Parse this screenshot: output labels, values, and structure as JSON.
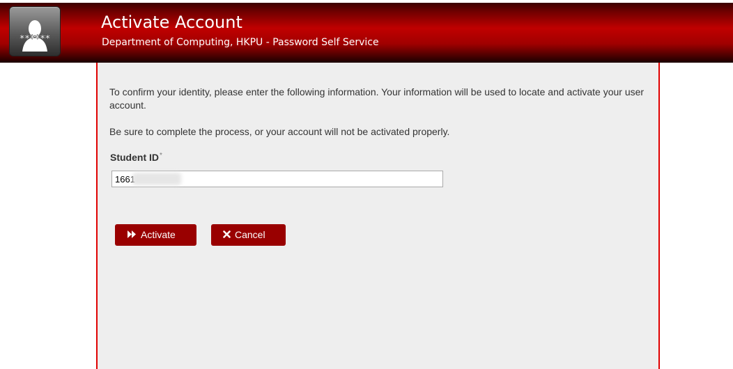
{
  "header": {
    "title": "Activate Account",
    "subtitle": "Department of Computing, HKPU - Password Self Service",
    "logo_icon": "user-password-icon",
    "logo_text": "******"
  },
  "form": {
    "intro": "To confirm your identity, please enter the following information. Your information will be used to locate and activate your user account.",
    "warning": "Be sure to complete the process, or your account will not be activated properly.",
    "student_id": {
      "label": "Student ID",
      "required_mark": "*",
      "value": "1661"
    }
  },
  "buttons": {
    "activate": {
      "label": "Activate",
      "icon": "fast-forward-icon"
    },
    "cancel": {
      "label": "Cancel",
      "icon": "close-icon"
    }
  },
  "colors": {
    "header_red": "#c00000",
    "button_bg": "#990000",
    "panel_bg": "#eeeeee",
    "panel_border": "#e00000"
  }
}
